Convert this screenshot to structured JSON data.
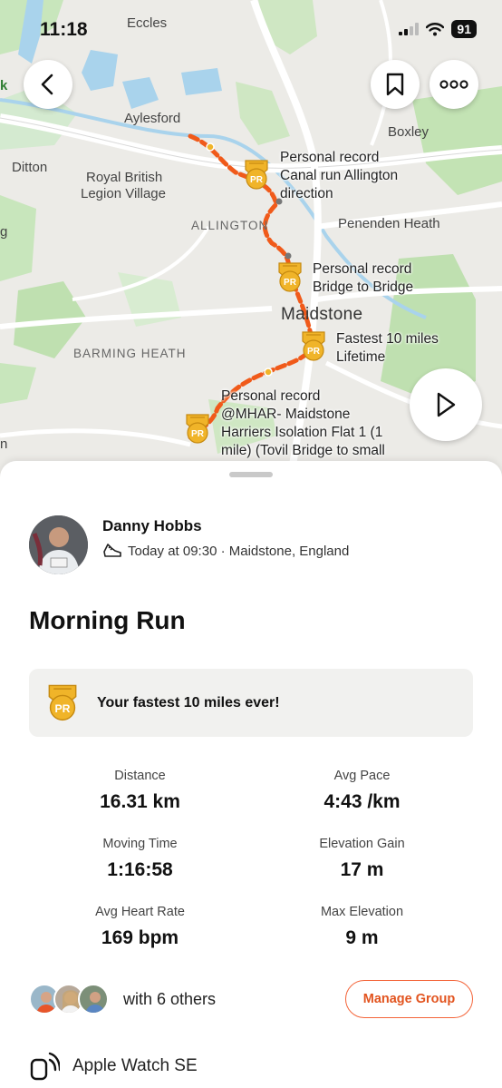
{
  "status_bar": {
    "time": "11:18",
    "battery": "91"
  },
  "map": {
    "places": [
      "Eccles",
      "Aylesford",
      "Boxley",
      "Ditton",
      "Royal British",
      "Legion Village",
      "ALLINGTON",
      "Penenden Heath",
      "Maidstone",
      "BARMING HEATH",
      "k",
      "g",
      "n"
    ],
    "pr_labels": [
      [
        "Personal record",
        "Canal run Allington",
        "direction"
      ],
      [
        "Personal record",
        "Bridge to Bridge"
      ],
      [
        "Fastest 10 miles",
        "Lifetime"
      ],
      [
        "Personal record",
        "@MHAR- Maidstone",
        "Harriers Isolation Flat 1 (1",
        "mile) (Tovil Bridge to small"
      ]
    ],
    "pr_badge_text": "PR",
    "route_color": "#f05a1a",
    "icons": {
      "back": "chevron-left-icon",
      "bookmark": "bookmark-icon",
      "more": "more-dots-icon",
      "play": "play-icon"
    }
  },
  "activity": {
    "athlete_name": "Danny Hobbs",
    "meta": "Today at 09:30 · Maidstone, England",
    "title": "Morning Run",
    "achievement": "Your fastest 10 miles ever!",
    "stats": [
      {
        "label": "Distance",
        "value": "16.31 km"
      },
      {
        "label": "Avg Pace",
        "value": "4:43 /km"
      },
      {
        "label": "Moving Time",
        "value": "1:16:58"
      },
      {
        "label": "Elevation Gain",
        "value": "17 m"
      },
      {
        "label": "Avg Heart Rate",
        "value": "169 bpm"
      },
      {
        "label": "Max Elevation",
        "value": "9 m"
      }
    ],
    "group_text": "with 6 others",
    "manage_group": "Manage Group",
    "device": "Apple Watch SE"
  },
  "colors": {
    "accent": "#f4653a",
    "pr_gold": "#f0b429",
    "map_green": "#bfe0b0",
    "map_water": "#a9d3ec"
  }
}
